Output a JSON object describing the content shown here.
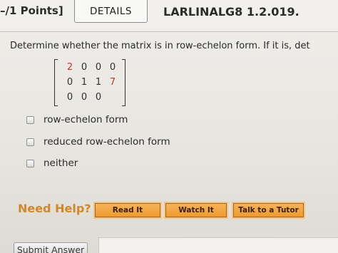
{
  "header": {
    "points": "–/1 Points]",
    "details_tab": "DETAILS",
    "problem_id": "LARLINALG8 1.2.019."
  },
  "question": {
    "text": "Determine whether the matrix is in row-echelon form. If it is, det"
  },
  "matrix": {
    "rows": [
      [
        "2",
        "0",
        "0",
        "0"
      ],
      [
        "0",
        "1",
        "1",
        "7"
      ],
      [
        "0",
        "0",
        "0",
        ""
      ]
    ],
    "highlight_color": "#c0392b"
  },
  "options": [
    {
      "label": "row-echelon form",
      "checked": false
    },
    {
      "label": "reduced row-echelon form",
      "checked": false
    },
    {
      "label": "neither",
      "checked": false
    }
  ],
  "help": {
    "title": "Need Help?",
    "read_label": "Read It",
    "watch_label": "Watch It",
    "tutor_label": "Talk to a Tutor",
    "accent_color": "#ee9a2f"
  },
  "footer": {
    "submit_label": "Submit Answer"
  }
}
